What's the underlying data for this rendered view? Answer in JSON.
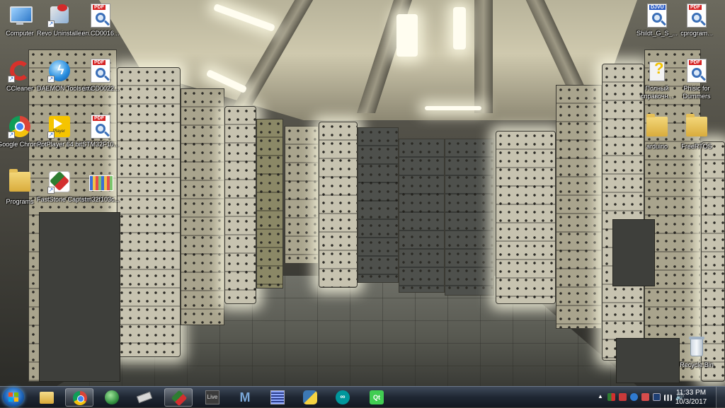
{
  "desktop": {
    "icons_left": [
      {
        "label": "Computer",
        "type": "computer"
      },
      {
        "label": "Revo Uninstaller",
        "type": "revo"
      },
      {
        "label": "en.CD0016...",
        "type": "pdf"
      },
      {
        "label": "CCleaner",
        "type": "ccleaner"
      },
      {
        "label": "DAEMON Tools Lite",
        "type": "daemon"
      },
      {
        "label": "en.CD0022...",
        "type": "pdf"
      },
      {
        "label": "Google Chrome",
        "type": "chrome"
      },
      {
        "label": "PotPlayer 64 bit",
        "type": "potplayer"
      },
      {
        "label": "STM32F10...",
        "type": "pdf"
      },
      {
        "label": "Programs",
        "type": "folder"
      },
      {
        "label": "FastStone Capture",
        "type": "faststone"
      },
      {
        "label": "stm32f103c...",
        "type": "image"
      }
    ],
    "icons_right": [
      {
        "label": "Shildt_G_S_...",
        "type": "djvu"
      },
      {
        "label": "cprogram...",
        "type": "pdf"
      },
      {
        "label": "Полный справочн...",
        "type": "help"
      },
      {
        "label": "Phisic for Dummers",
        "type": "pdf"
      },
      {
        "label": "arduino",
        "type": "folder"
      },
      {
        "label": "FreeRTOS",
        "type": "folder"
      }
    ],
    "recycle_bin": {
      "label": "Recycle Bin"
    },
    "file_badges": {
      "pdf": "PDF",
      "djvu": "DJVU",
      "potplayer": "Player"
    }
  },
  "taskbar": {
    "start": {
      "name": "windows-start"
    },
    "pinned": [
      {
        "name": "file-explorer",
        "active": false
      },
      {
        "name": "google-chrome",
        "active": true
      },
      {
        "name": "globe-app",
        "active": false
      },
      {
        "name": "chip-app",
        "active": false
      },
      {
        "name": "faststone-capture",
        "active": true
      },
      {
        "name": "ableton-live",
        "label": "Live",
        "active": false
      },
      {
        "name": "matlab-app",
        "label": "M",
        "active": false
      },
      {
        "name": "equalizer-app",
        "active": false
      },
      {
        "name": "python-app",
        "active": false
      },
      {
        "name": "arduino-app",
        "active": false
      },
      {
        "name": "qt-creator",
        "label": "Qt",
        "active": false
      }
    ],
    "tray": {
      "overflow_label": "▲",
      "clock_time": "11:33 PM",
      "clock_date": "10/3/2017"
    }
  },
  "colors": {
    "taskbar_top": "#3f4a5a",
    "taskbar_bottom": "#131922",
    "icon_label": "#ffffff"
  }
}
